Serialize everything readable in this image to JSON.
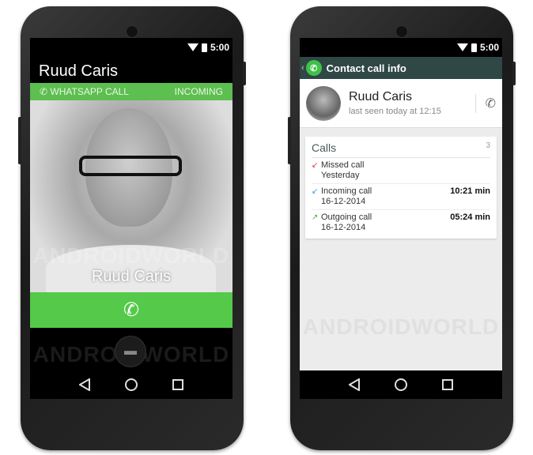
{
  "left": {
    "status_time": "5:00",
    "contact_name": "Ruud Caris",
    "banner_left": "WHATSAPP CALL",
    "banner_right": "INCOMING",
    "photo_name": "Ruud Caris",
    "watermark": "ANDROIDWORLD"
  },
  "right": {
    "status_time": "5:00",
    "toolbar_title": "Contact call info",
    "contact_name": "Ruud Caris",
    "last_seen": "last seen today at 12:15",
    "calls_title": "Calls",
    "calls_count": "3",
    "calls": [
      {
        "type": "Missed call",
        "date": "Yesterday",
        "duration": "",
        "arrow": "↙",
        "color": "#e53935"
      },
      {
        "type": "Incoming call",
        "date": "16-12-2014",
        "duration": "10:21 min",
        "arrow": "↙",
        "color": "#29a3e0"
      },
      {
        "type": "Outgoing call",
        "date": "16-12-2014",
        "duration": "05:24 min",
        "arrow": "↗",
        "color": "#3cb34a"
      }
    ],
    "watermark": "ANDROIDWORLD"
  },
  "colors": {
    "whatsapp_green": "#5cbf4f",
    "toolbar": "#2f4745"
  }
}
